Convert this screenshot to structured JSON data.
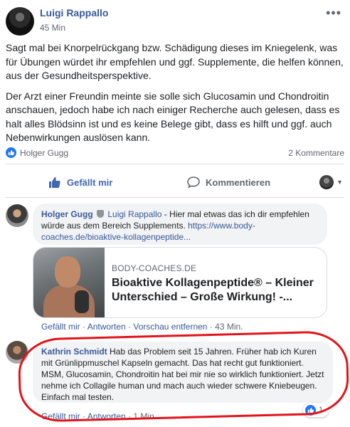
{
  "post": {
    "author": "Luigi Rappallo",
    "timestamp": "45 Min",
    "paragraphs": [
      "Sagt mal bei Knorpelrückgang bzw. Schädigung dieses im Kniegelenk, was für Übungen würdet ihr empfehlen und ggf. Supplemente, die helfen können, aus der Gesundheitsperspektive.",
      "Der Arzt einer Freundin meinte sie solle sich Glucosamin und Chondroitin anschauen, jedoch habe ich nach einiger Recherche auch gelesen, dass es halt alles Blödsinn ist und es keine Belege gibt, dass es hilft und ggf. auch Nebenwirkungen auslösen kann."
    ],
    "reaction_name": "Holger Gugg",
    "comment_count": "2 Kommentare"
  },
  "actions": {
    "like": "Gefällt mir",
    "comment": "Kommentieren"
  },
  "comments": [
    {
      "author": "Holger Gugg",
      "tagged": "Luigi Rappallo",
      "text": " - Hier mal etwas das ich dir empfehlen würde aus dem Bereich Supplements. ",
      "link": "https://www.body-coaches.de/bioaktive-kollagenpeptide...",
      "card": {
        "domain": "BODY-COACHES.DE",
        "title": "Bioaktive Kollagenpeptide® – Kleiner Unterschied – Große Wirkung! -..."
      },
      "actions": {
        "like": "Gefällt mir",
        "reply": "Antworten",
        "remove_preview": "Vorschau entfernen",
        "time": "43 Min."
      }
    },
    {
      "author": "Kathrin Schmidt",
      "text": "Hab das Problem seit 15 Jahren. Früher hab ich Kuren mit Grünlippmuschel Kapseln gemacht. Das hat recht gut funktioniert. MSM, Glucosamin, Chondroitin hat bei mir nie so wirklich funktioniert. Jetzt nehme ich Collagile human und mach auch wieder schwere Kniebeugen. Einfach mal testen.",
      "reaction_count": "1",
      "actions": {
        "like": "Gefällt mir",
        "reply": "Antworten",
        "time": "1 Min."
      }
    }
  ],
  "separator": " · ",
  "colors": {
    "link": "#385898",
    "like_blue": "#2078f4",
    "annotation": "#e0151b"
  },
  "icons": [
    "more-dots-icon",
    "like-thumb-icon",
    "comment-bubble-icon",
    "shield-icon",
    "chevron-down-icon"
  ]
}
